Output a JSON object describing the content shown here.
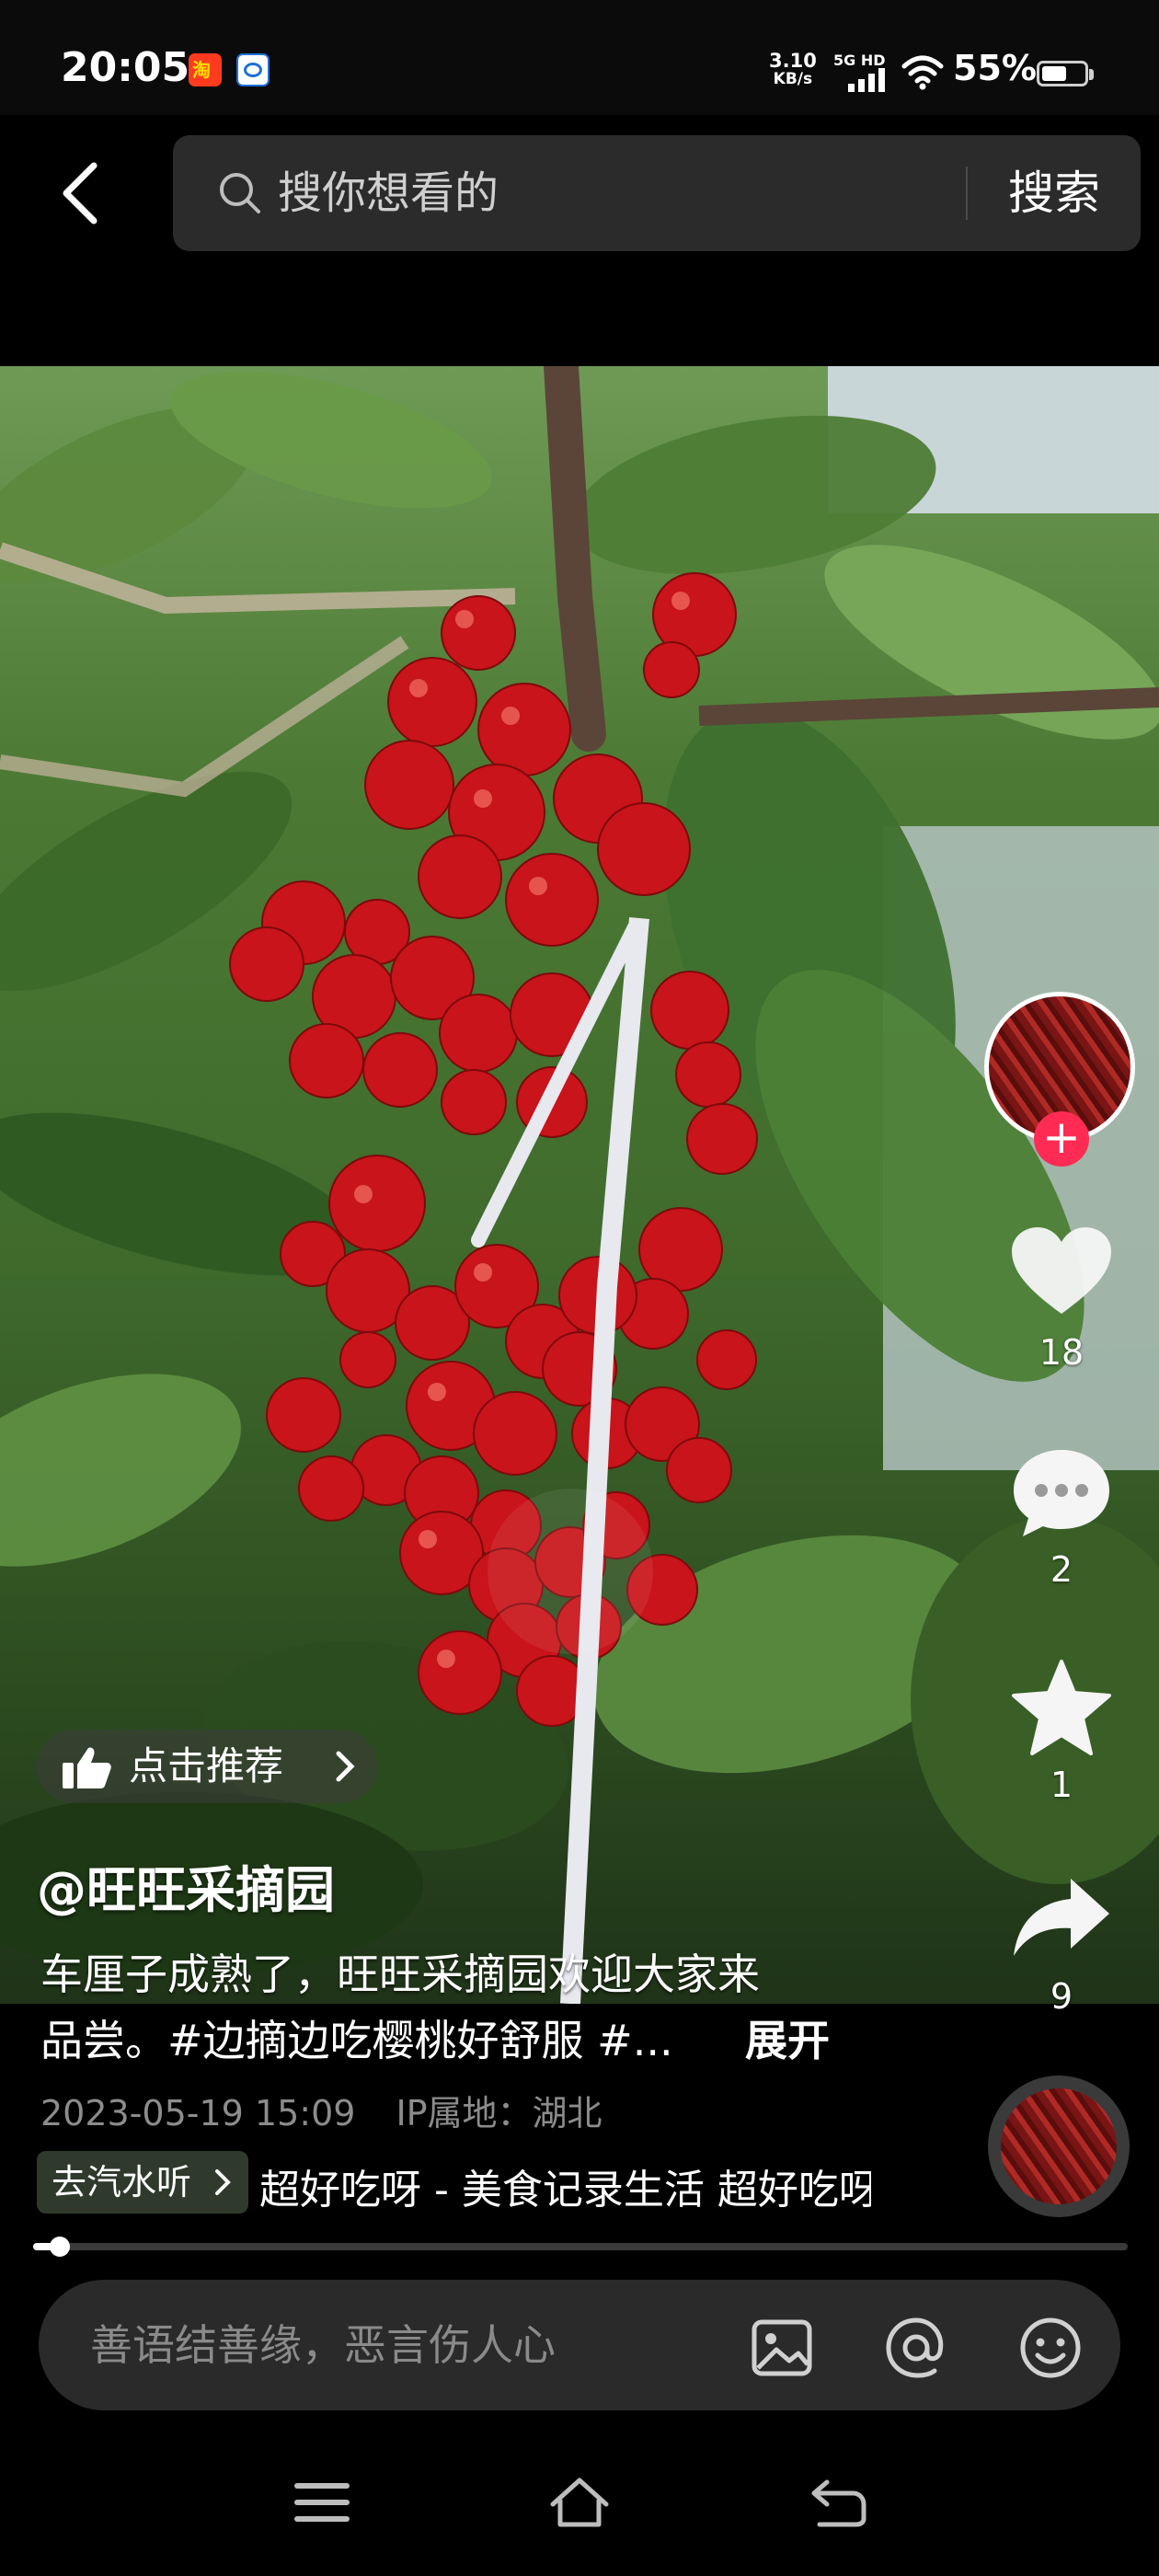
{
  "status_bar": {
    "time": "20:05",
    "app_badges": [
      "taobao-icon",
      "browser-icon"
    ],
    "taobao_badge_text": "淘",
    "net_speed_value": "3.10",
    "net_speed_unit": "KB/s",
    "signal_label": "5G HD",
    "battery_percent": "55%",
    "battery_level": 0.55
  },
  "header": {
    "back_icon": "back-arrow-icon",
    "search_placeholder": "搜你想看的",
    "search_button": "搜索"
  },
  "actions": {
    "like_count": "18",
    "comment_count": "2",
    "favorite_count": "1",
    "share_count": "9",
    "follow_symbol": "+"
  },
  "post": {
    "recommend_label": "点击推荐",
    "author": "@旺旺采摘园",
    "caption_line1": "车厘子成熟了，旺旺采摘园欢迎大家来",
    "caption_line2": "品尝。#边摘边吃樱桃好舒服 #...",
    "expand_label": "展开",
    "date": "2023-05-19 15:09",
    "ip_location": "IP属地：湖北"
  },
  "music": {
    "chip_label": "去汽水听",
    "title": "超好吃呀 - 美食记录生活    超好吃呀 - 美食记录生活"
  },
  "progress": {
    "fraction": 0.02
  },
  "comment_bar": {
    "placeholder": "善语结善缘，恶言伤人心",
    "icons": [
      "image-icon",
      "at-mention-icon",
      "emoji-icon"
    ]
  },
  "nav_bar": {
    "icons": [
      "menu-icon",
      "home-icon",
      "back-nav-icon"
    ]
  },
  "colors": {
    "accent": "#fe2c55",
    "search_bg": "#2b2b2b",
    "chip_bg": "#2f3a2c",
    "cherry_red": "#c8141a"
  }
}
